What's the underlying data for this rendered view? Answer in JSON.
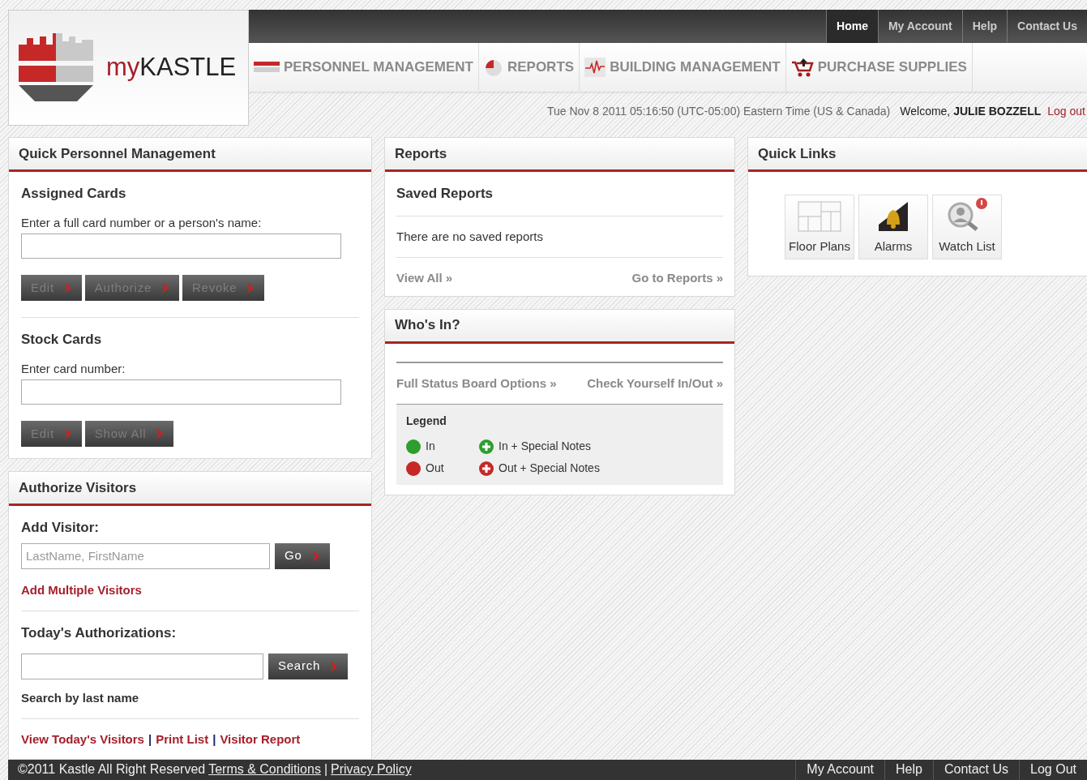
{
  "logo": {
    "prefix": "my",
    "name": "KASTLE"
  },
  "top_tabs": [
    {
      "label": "Home",
      "selected": true
    },
    {
      "label": "My Account",
      "selected": false
    },
    {
      "label": "Help",
      "selected": false
    },
    {
      "label": "Contact Us",
      "selected": false
    }
  ],
  "nav": [
    {
      "kind": "personnel",
      "label": "PERSONNEL MANAGEMENT"
    },
    {
      "kind": "reports",
      "label": "REPORTS"
    },
    {
      "kind": "building",
      "label": "BUILDING MANAGEMENT"
    },
    {
      "kind": "supplies",
      "label": "PURCHASE SUPPLIES"
    }
  ],
  "status_line": {
    "datetime": "Tue Nov 8 2011 05:16:50 (UTC-05:00) Eastern Time (US & Canada)",
    "welcome": "Welcome, **JULIE BOZZELL**",
    "logout": "Log out"
  },
  "quick_personnel": {
    "title": "Quick Personnel Management",
    "sections": [
      {
        "heading": "Assigned Cards",
        "label": "Enter a full card number or a person's name:",
        "buttons": [
          {
            "label": "Edit",
            "disabled": true
          },
          {
            "label": "Authorize",
            "disabled": true
          },
          {
            "label": "Revoke",
            "disabled": true
          }
        ]
      },
      {
        "heading": "Stock Cards",
        "label": "Enter card number:",
        "buttons": [
          {
            "label": "Edit",
            "disabled": true
          },
          {
            "label": "Show All",
            "disabled": true
          }
        ]
      }
    ]
  },
  "authorize_visitors": {
    "title": "Authorize Visitors",
    "add_heading": "Add Visitor:",
    "add_placeholder": "LastName, FirstName",
    "go_button": {
      "label": "Go",
      "disabled": false
    },
    "add_multiple": "Add Multiple Visitors",
    "today_heading": "Today's Authorizations:",
    "search_button": {
      "label": "Search",
      "disabled": false
    },
    "search_hint": "Search by last name",
    "links": [
      "View Today's Visitors",
      "Print List",
      "Visitor Report"
    ],
    "separators": [
      "|",
      "|"
    ]
  },
  "reports": {
    "title": "Reports",
    "heading": "Saved Reports",
    "empty": "There are no saved reports",
    "view_all": "View All »",
    "go_to": "Go to Reports »"
  },
  "whos_in": {
    "title": "Who's In?",
    "options": "Full Status Board Options »",
    "check": "Check Yourself In/Out »",
    "legend_title": "Legend",
    "legend": [
      {
        "label": "In",
        "kind": "plain",
        "color": "#2e9e2e"
      },
      {
        "label": "In + Special Notes",
        "kind": "plus",
        "color": "#2e9e2e"
      },
      {
        "label": "Out",
        "kind": "plain",
        "color": "#c62828"
      },
      {
        "label": "Out + Special Notes",
        "kind": "plus",
        "color": "#c62828"
      }
    ]
  },
  "quick_links": {
    "title": "Quick Links",
    "items": [
      {
        "kind": "floorplan",
        "label": "Floor Plans"
      },
      {
        "kind": "alarm",
        "label": "Alarms"
      },
      {
        "kind": "watch",
        "label": "Watch List"
      }
    ]
  },
  "footer": {
    "copyright": "©2011 Kastle All Right Reserved",
    "links": [
      "Terms & Conditions",
      "Privacy Policy"
    ],
    "separator": "|",
    "right_links": [
      "My Account",
      "Help",
      "Contact Us",
      "Log Out"
    ]
  }
}
